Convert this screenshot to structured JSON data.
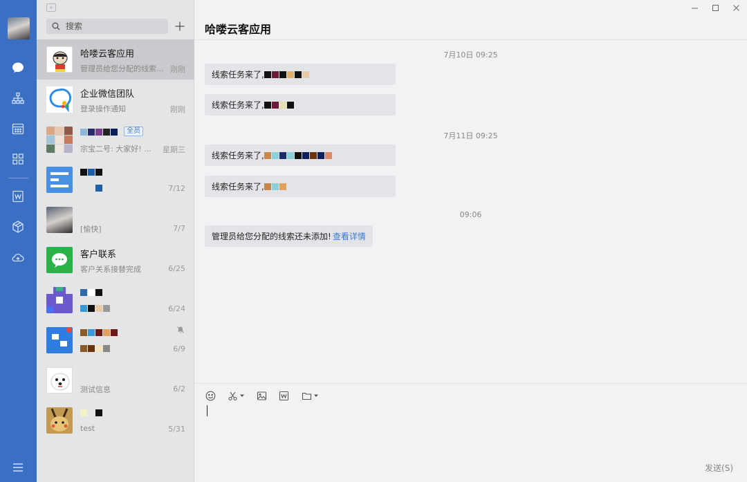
{
  "colors": {
    "rail": "#3a6fc4",
    "accent": "#3a78d6",
    "active_item": "#c9cacd"
  },
  "rail": {
    "items": [
      {
        "name": "message-icon"
      },
      {
        "name": "org-chart-icon"
      },
      {
        "name": "calendar-icon"
      },
      {
        "name": "apps-grid-icon"
      },
      {
        "name": "word-doc-icon"
      },
      {
        "name": "cube-icon"
      },
      {
        "name": "cloud-icon"
      },
      {
        "name": "menu-icon"
      }
    ]
  },
  "search": {
    "placeholder": "搜索"
  },
  "conversations": [
    {
      "name": "哈喽云客应用",
      "preview": "管理员给您分配的线索...",
      "time": "刚刚",
      "active": true
    },
    {
      "name": "企业微信团队",
      "preview": "登录操作通知",
      "time": "刚刚"
    },
    {
      "name": "",
      "tag": "全员",
      "preview": "宗宝二号: 大家好! ...",
      "time": "星期三"
    },
    {
      "name": "",
      "preview": "",
      "time": "7/12"
    },
    {
      "name": "",
      "preview": "[愉快]",
      "time": "7/7"
    },
    {
      "name": "客户联系",
      "preview": "客户关系接替完成",
      "time": "6/25"
    },
    {
      "name": "",
      "preview": "",
      "time": "6/24"
    },
    {
      "name": "",
      "preview": "",
      "time": "6/9"
    },
    {
      "name": "",
      "preview": "测试信息",
      "time": "6/2"
    },
    {
      "name": "",
      "preview": "test",
      "time": "5/31"
    }
  ],
  "chat": {
    "title": "哈喽云客应用",
    "messages": [
      {
        "type": "time",
        "text": "7月10日 09:25"
      },
      {
        "type": "bubble",
        "text": "线索任务来了,"
      },
      {
        "type": "bubble",
        "text": "线索任务来了,"
      },
      {
        "type": "time",
        "text": "7月11日 09:25"
      },
      {
        "type": "bubble",
        "text": "线索任务来了,"
      },
      {
        "type": "bubble",
        "text": "线索任务来了,"
      },
      {
        "type": "time",
        "text": "09:06"
      },
      {
        "type": "bubble",
        "text": "管理员给您分配的线索还未添加!",
        "link": "查看详情"
      }
    ]
  },
  "composer": {
    "tools": [
      "emoji-icon",
      "scissors-icon",
      "image-icon",
      "word-file-icon",
      "folder-icon"
    ],
    "send_label": "发送(S)"
  }
}
